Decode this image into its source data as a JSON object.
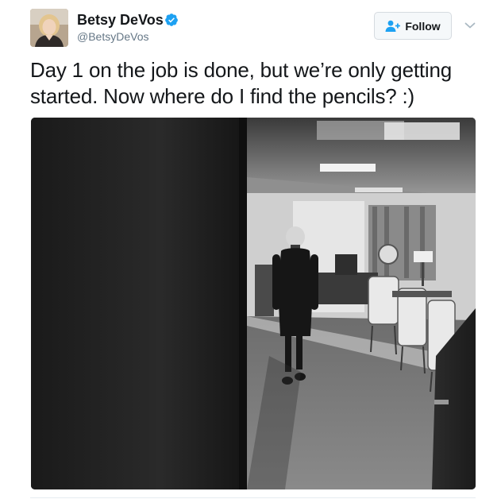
{
  "author": {
    "display_name": "Betsy DeVos",
    "handle": "@BetsyDeVos",
    "verified": true,
    "avatar_icon": "profile-photo"
  },
  "actions": {
    "follow_label": "Follow",
    "follow_icon": "add-user-icon",
    "menu_icon": "chevron-down-icon"
  },
  "tweet": {
    "text": "Day 1 on the job is done, but we’re only getting started. Now where do I find the pencils? :)"
  },
  "colors": {
    "name_text": "#14171a",
    "secondary_text": "#657786",
    "verified_badge": "#1da1f2",
    "button_bg": "#f5f8fa",
    "button_border": "#d6dbe0"
  }
}
